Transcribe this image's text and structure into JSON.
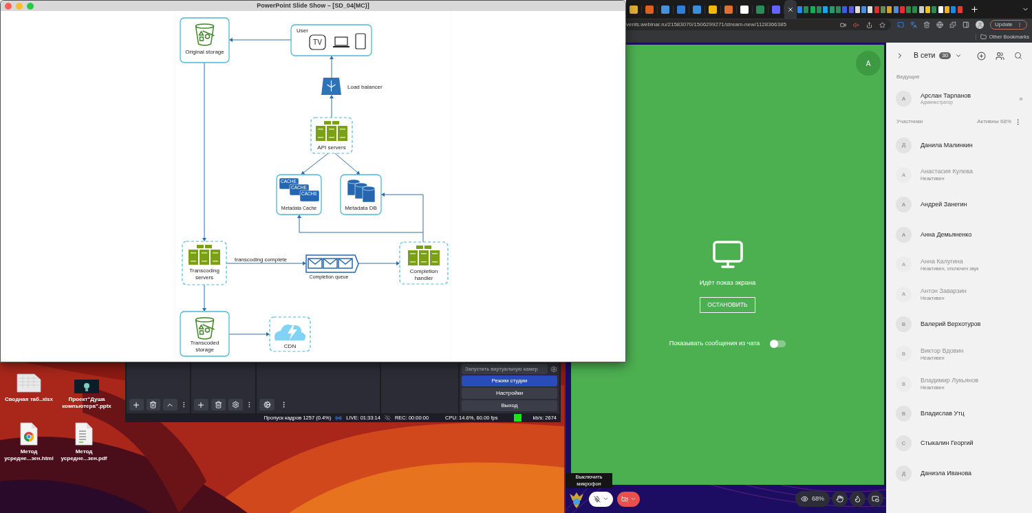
{
  "desktop": {
    "files": [
      {
        "kind": "spreadsheet",
        "label": "Сводная таб..xlsx"
      },
      {
        "kind": "presentation",
        "label": "Проект\"Душа компьютера\".pptx"
      },
      {
        "kind": "html",
        "label": "Метод усредне...зен.html"
      },
      {
        "kind": "pdf",
        "label": "Метод усредне...зен.pdf"
      }
    ]
  },
  "slideshow_window": {
    "title": "PowerPoint Slide Show – [SD_04(MC)]",
    "diagram": {
      "nodes": [
        {
          "kind": "storage",
          "label": "Original storage"
        },
        {
          "kind": "user",
          "label": "User",
          "icon_texts": [
            "TV"
          ]
        },
        {
          "kind": "load_balancer",
          "label": "Load balancer"
        },
        {
          "kind": "server_group",
          "label": "API servers"
        },
        {
          "kind": "cache",
          "label": "Metadata Cache",
          "icon_texts": [
            "CACHE",
            "CACHE",
            "CACHE"
          ]
        },
        {
          "kind": "database",
          "label": "Metadata DB"
        },
        {
          "kind": "server_group",
          "label": "Transcoding servers"
        },
        {
          "kind": "queue",
          "label": "Completion queue"
        },
        {
          "kind": "server_group",
          "label": "Completion handler"
        },
        {
          "kind": "storage",
          "label": "Transcoded storage"
        },
        {
          "kind": "cdn",
          "label": "CDN"
        }
      ],
      "edge_labels": [
        "transcoding complete"
      ]
    }
  },
  "obs_window": {
    "virtual_camera_button": "Запустить виртуальную камер",
    "buttons": [
      {
        "label": "Режим студии",
        "selected": true
      },
      {
        "label": "Настройки",
        "selected": false
      },
      {
        "label": "Выход",
        "selected": false
      }
    ],
    "status_bar": {
      "dropped_frames": "Пропуск кадров 1257 (0.4%)",
      "live": "LIVE: 01:33:14",
      "rec": "REC: 00:00:00",
      "cpu": "CPU: 14.6%, 60.00 fps",
      "bitrate": "kb/s: 2674"
    }
  },
  "browser": {
    "address": "vents.webinar.ru/21583070/1506299271/stream-new/1128366385",
    "update_button": "Update",
    "bookmarks": [
      "Other Bookmarks"
    ]
  },
  "webinar": {
    "avatar": "А",
    "screen_share": {
      "message": "Идёт показ экрана",
      "stop_button": "ОСТАНОВИТЬ",
      "chat_toggle": {
        "label": "Показывать сообщения из чата",
        "on": false
      }
    },
    "toolbar": {
      "tooltip": "Выключить микрофон",
      "viewers": "68%"
    }
  },
  "sidebar": {
    "title": "В сети",
    "count": "30",
    "hosts_heading": "Ведущие",
    "hosts": [
      {
        "initial": "А",
        "name": "Арслан Тарланов",
        "role": "Администратор",
        "tag": "я"
      }
    ],
    "participants_heading": "Участники",
    "active_label": "Активны 68%",
    "participants": [
      {
        "initial": "Д",
        "name": "Данила Малинкин",
        "active": true
      },
      {
        "initial": "А",
        "name": "Анастасия Кулева",
        "active": false,
        "status": "Неактивен"
      },
      {
        "initial": "А",
        "name": "Андрей Занегин",
        "active": true
      },
      {
        "initial": "А",
        "name": "Анна Демьяненко",
        "active": true
      },
      {
        "initial": "А",
        "name": "Анна Калугина",
        "active": false,
        "status": "Неактивен, отключен звук"
      },
      {
        "initial": "А",
        "name": "Антон Заварзин",
        "active": false,
        "status": "Неактивен"
      },
      {
        "initial": "В",
        "name": "Валерий Верхотуров",
        "active": true
      },
      {
        "initial": "В",
        "name": "Виктор Вдовин",
        "active": false,
        "status": "Неактивен"
      },
      {
        "initial": "В",
        "name": "Владимир Лукьянов",
        "active": false,
        "status": "Неактивен"
      },
      {
        "initial": "В",
        "name": "Владислав Утц",
        "active": true
      },
      {
        "initial": "С",
        "name": "Стыкалин Георгий",
        "active": true
      },
      {
        "initial": "Д",
        "name": "Даниэла Иванова",
        "active": true
      }
    ]
  }
}
